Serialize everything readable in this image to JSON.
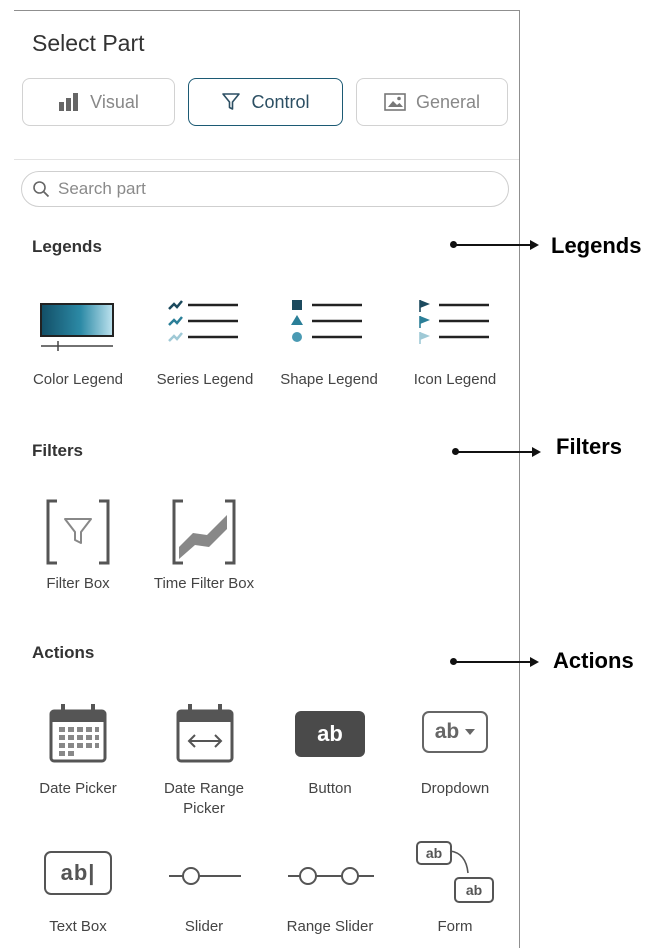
{
  "panel": {
    "title": "Select Part",
    "tabs": [
      {
        "label": "Visual",
        "icon": "bar-chart-icon",
        "active": false
      },
      {
        "label": "Control",
        "icon": "filter-icon",
        "active": true
      },
      {
        "label": "General",
        "icon": "image-icon",
        "active": false
      }
    ],
    "search": {
      "placeholder": "Search part",
      "icon": "search-icon"
    }
  },
  "sections": {
    "legends": {
      "title": "Legends",
      "items": [
        {
          "label": "Color Legend",
          "icon": "color-legend-icon"
        },
        {
          "label": "Series Legend",
          "icon": "series-legend-icon"
        },
        {
          "label": "Shape Legend",
          "icon": "shape-legend-icon"
        },
        {
          "label": "Icon Legend",
          "icon": "icon-legend-icon"
        }
      ]
    },
    "filters": {
      "title": "Filters",
      "items": [
        {
          "label": "Filter Box",
          "icon": "filter-box-icon"
        },
        {
          "label": "Time Filter Box",
          "icon": "time-filter-box-icon"
        }
      ]
    },
    "actions": {
      "title": "Actions",
      "items": [
        {
          "label": "Date Picker",
          "icon": "calendar-icon"
        },
        {
          "label": "Date Range",
          "label2": "Picker",
          "icon": "date-range-icon"
        },
        {
          "label": "Button",
          "icon": "button-icon",
          "icon_text": "ab"
        },
        {
          "label": "Dropdown",
          "icon": "dropdown-icon",
          "icon_text": "ab"
        },
        {
          "label": "Text Box",
          "icon": "text-box-icon",
          "icon_text": "ab|"
        },
        {
          "label": "Slider",
          "icon": "slider-icon"
        },
        {
          "label": "Range Slider",
          "icon": "range-slider-icon"
        },
        {
          "label": "Form",
          "icon": "form-icon",
          "icon_text": "ab"
        }
      ]
    }
  },
  "annotations": [
    "Legends",
    "Filters",
    "Actions"
  ],
  "colors": {
    "accent": "#1c5a74",
    "icon_dark": "#555555",
    "icon_gray": "#888888",
    "button_dark": "#4a4a4a"
  }
}
